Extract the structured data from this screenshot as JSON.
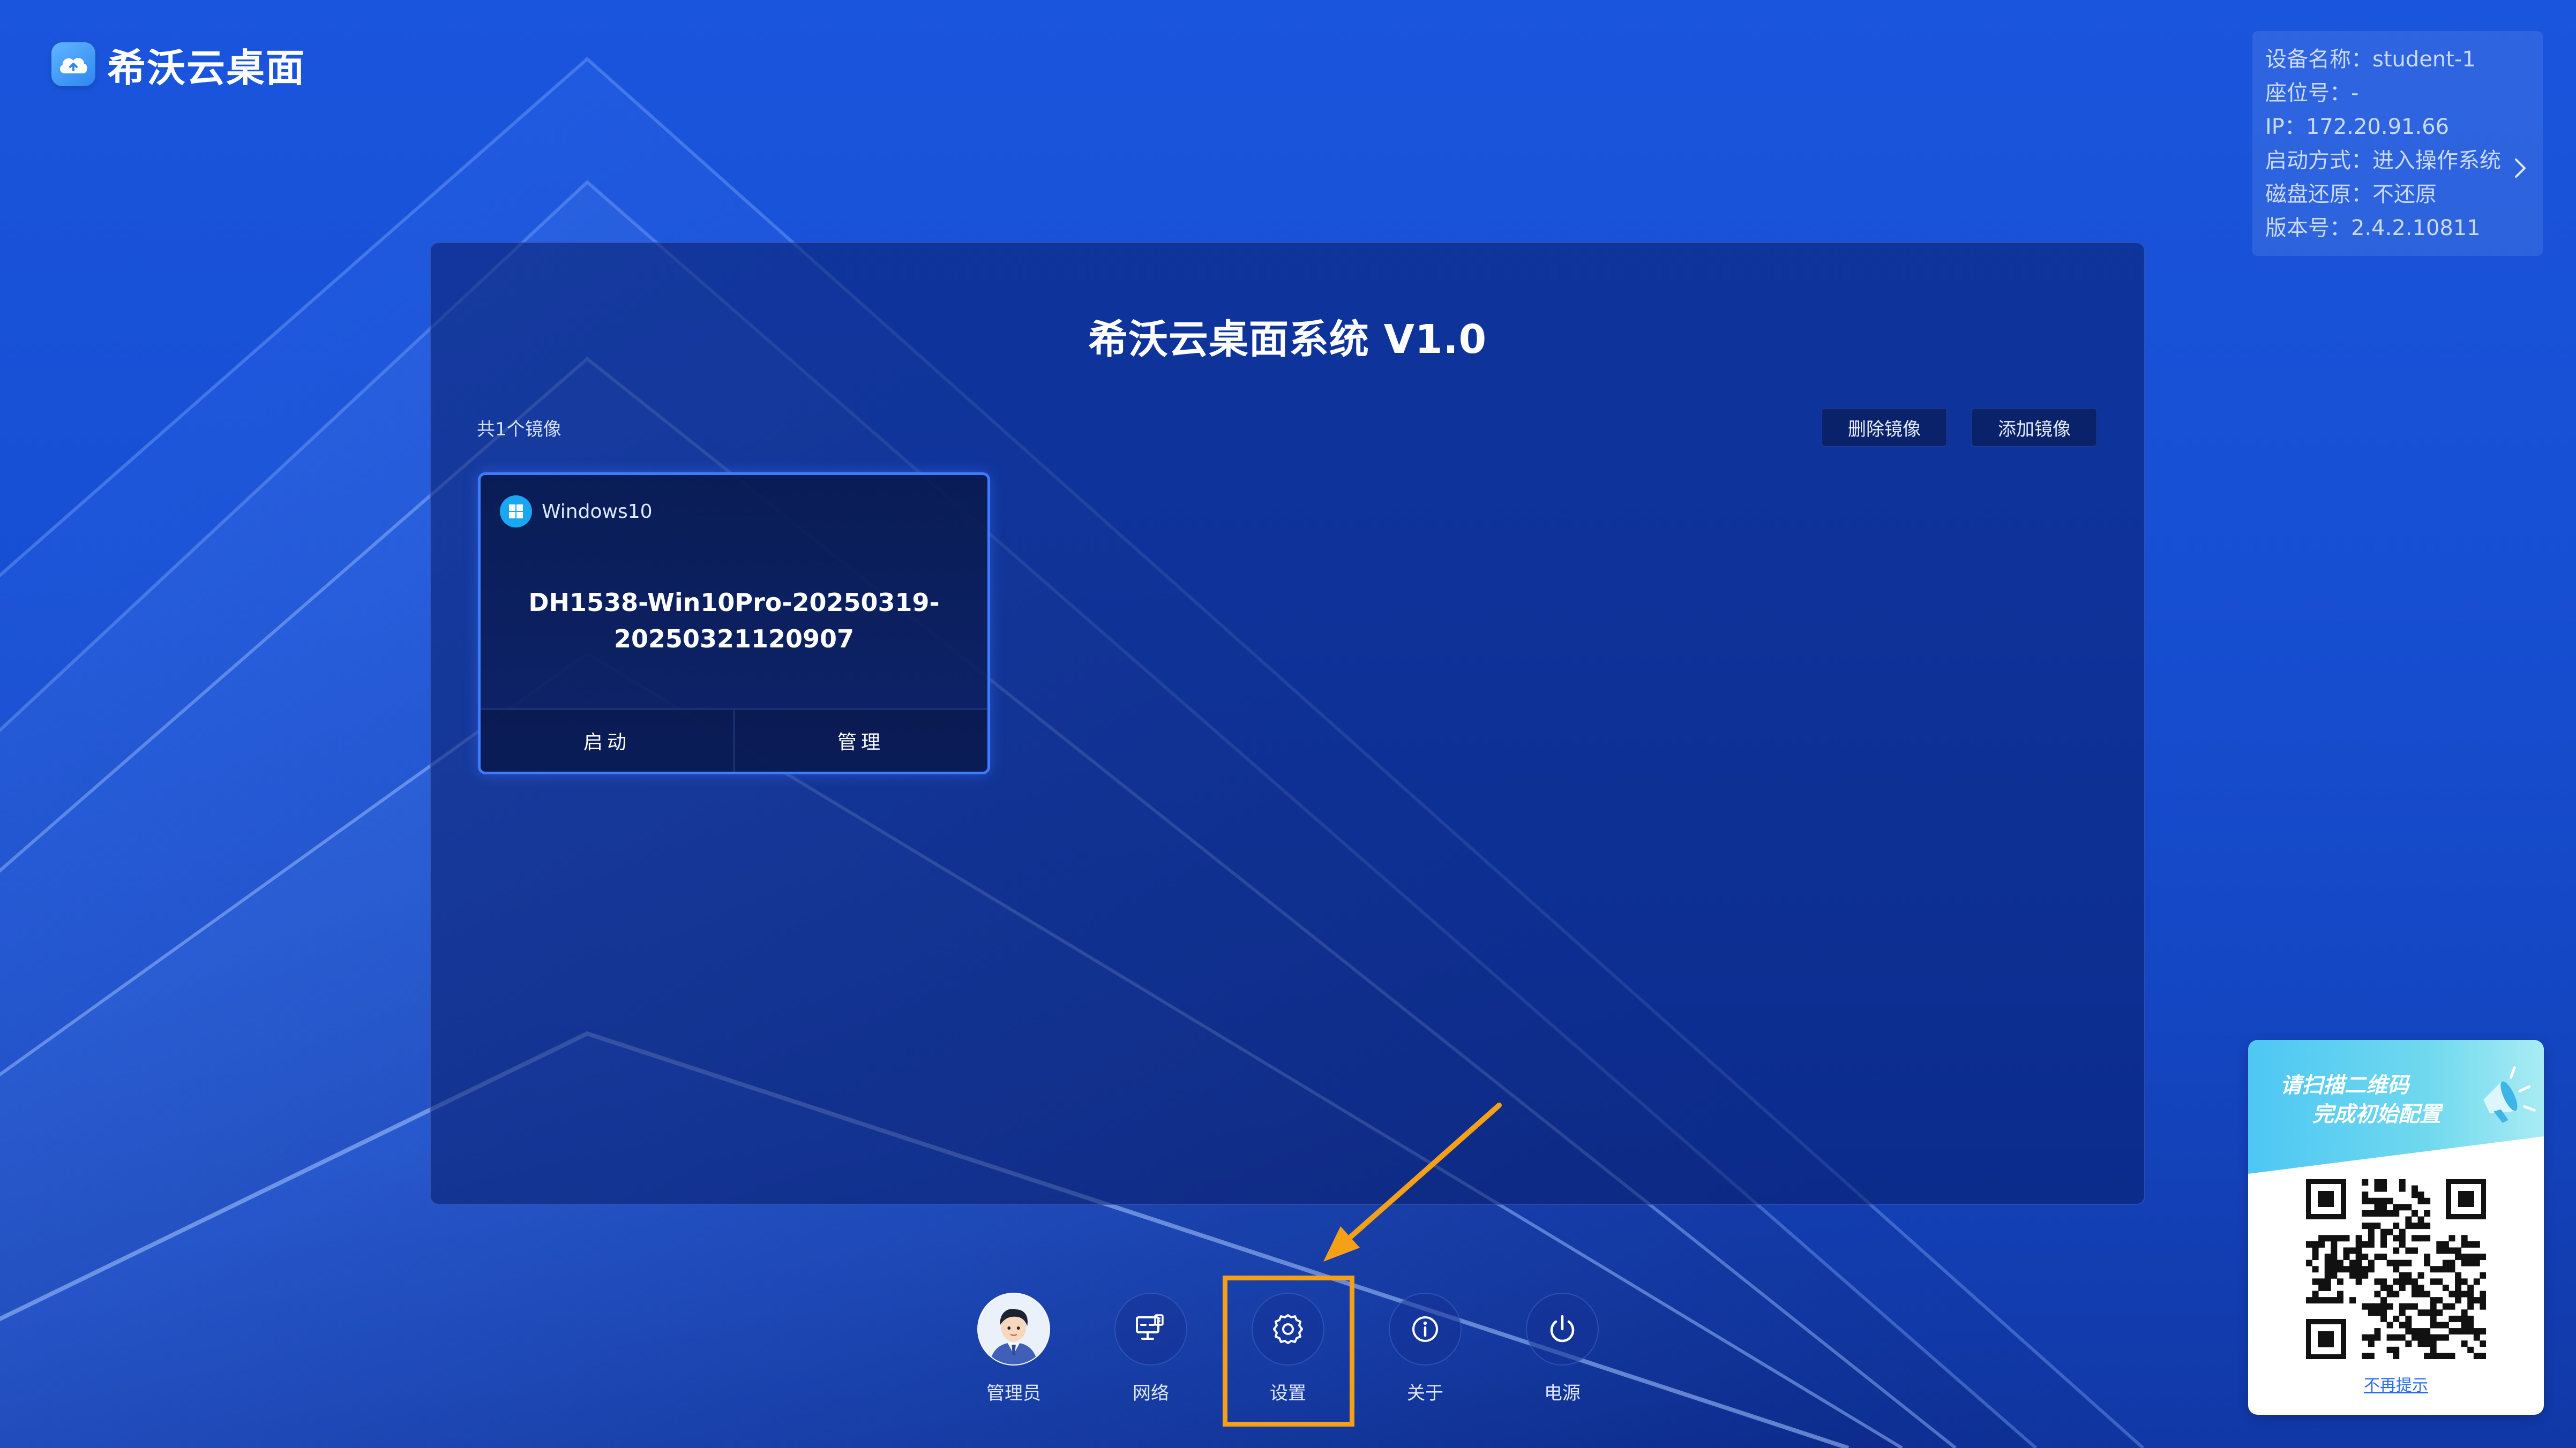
{
  "app": {
    "name": "希沃云桌面"
  },
  "device_info": {
    "rows": [
      "设备名称：student-1",
      "座位号：-",
      "IP：172.20.91.66",
      "启动方式：进入操作系统",
      "磁盘还原：不还原",
      "版本号：2.4.2.10811"
    ],
    "expand_icon": "chevron-right-icon"
  },
  "panel": {
    "title": "希沃云桌面系统 V1.0",
    "image_count": "共1个镜像",
    "delete_button": "删除镜像",
    "add_button": "添加镜像"
  },
  "image_card": {
    "os_name": "Windows10",
    "image_name": "DH1538-Win10Pro-20250319-20250321120907",
    "start_button": "启动",
    "manage_button": "管理"
  },
  "dock": {
    "items": [
      {
        "label": "管理员",
        "icon": "avatar-icon"
      },
      {
        "label": "网络",
        "icon": "network-icon"
      },
      {
        "label": "设置",
        "icon": "gear-icon"
      },
      {
        "label": "关于",
        "icon": "info-icon"
      },
      {
        "label": "电源",
        "icon": "power-icon"
      }
    ]
  },
  "qr_card": {
    "line1": "请扫描二维码",
    "line2": "完成初始配置",
    "dismiss": "不再提示"
  },
  "colors": {
    "background": "#1a55dd",
    "accent": "#3e7bff",
    "highlight": "#f5a017"
  }
}
